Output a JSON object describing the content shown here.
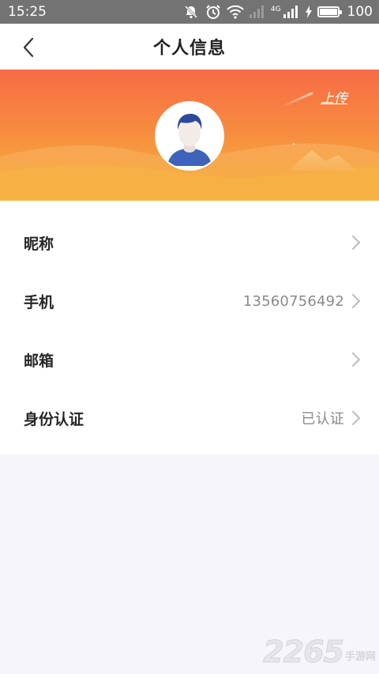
{
  "status_bar": {
    "time": "15:25",
    "network_label": "4G",
    "battery": "100",
    "icons": [
      "mute-icon",
      "alarm-icon",
      "wifi-icon",
      "signal-icon",
      "signal-4g-icon",
      "charging-icon",
      "battery-icon"
    ]
  },
  "header": {
    "title": "个人信息",
    "back_icon": "chevron-left-icon"
  },
  "banner": {
    "upload_label": "上传",
    "colors": {
      "top": "#f76b45",
      "bottom": "#f5b13b"
    }
  },
  "profile_rows": [
    {
      "label": "昵称",
      "value": ""
    },
    {
      "label": "手机",
      "value": "13560756492"
    },
    {
      "label": "邮箱",
      "value": ""
    },
    {
      "label": "身份认证",
      "value": "已认证"
    }
  ],
  "watermark": {
    "number": "2265",
    "text": "手游网"
  }
}
